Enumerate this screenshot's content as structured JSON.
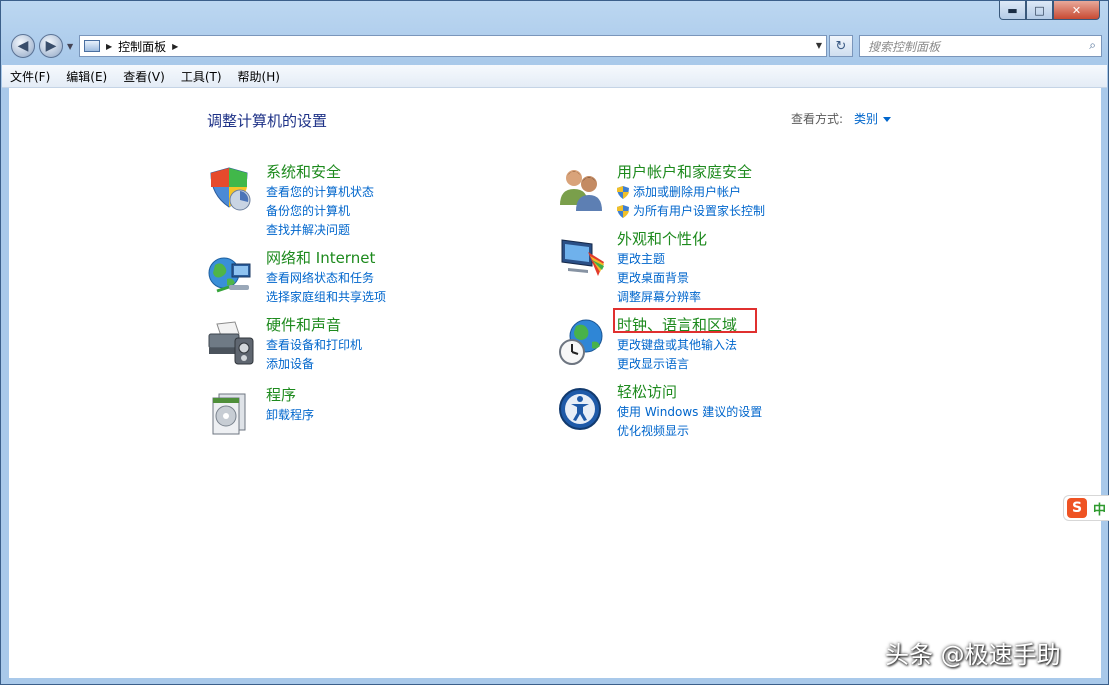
{
  "window": {
    "controls": {
      "minimize": "▬",
      "maximize": "□",
      "close": "✕"
    }
  },
  "nav": {
    "back_icon": "arrow-left-icon",
    "forward_icon": "arrow-right-icon",
    "breadcrumb": "控制面板",
    "search_placeholder": "搜索控制面板"
  },
  "menu": [
    "文件(F)",
    "编辑(E)",
    "查看(V)",
    "工具(T)",
    "帮助(H)"
  ],
  "page": {
    "title": "调整计算机的设置",
    "view_by_label": "查看方式:",
    "view_by_value": "类别"
  },
  "categories": [
    {
      "title": "系统和安全",
      "icon": "shield-icon",
      "links": [
        {
          "text": "查看您的计算机状态"
        },
        {
          "text": "备份您的计算机"
        },
        {
          "text": "查找并解决问题"
        }
      ]
    },
    {
      "title": "网络和 Internet",
      "icon": "network-globe-icon",
      "links": [
        {
          "text": "查看网络状态和任务"
        },
        {
          "text": "选择家庭组和共享选项"
        }
      ]
    },
    {
      "title": "硬件和声音",
      "icon": "printer-icon",
      "links": [
        {
          "text": "查看设备和打印机"
        },
        {
          "text": "添加设备"
        }
      ]
    },
    {
      "title": "程序",
      "icon": "programs-icon",
      "links": [
        {
          "text": "卸载程序"
        }
      ]
    },
    {
      "title": "用户帐户和家庭安全",
      "icon": "users-icon",
      "links": [
        {
          "text": "添加或删除用户帐户",
          "shield": true
        },
        {
          "text": "为所有用户设置家长控制",
          "shield": true
        }
      ]
    },
    {
      "title": "外观和个性化",
      "icon": "monitor-icon",
      "links": [
        {
          "text": "更改主题"
        },
        {
          "text": "更改桌面背景"
        },
        {
          "text": "调整屏幕分辨率"
        }
      ]
    },
    {
      "title": "时钟、语言和区域",
      "icon": "clock-globe-icon",
      "links": [
        {
          "text": "更改键盘或其他输入法"
        },
        {
          "text": "更改显示语言"
        }
      ]
    },
    {
      "title": "轻松访问",
      "icon": "ease-of-access-icon",
      "links": [
        {
          "text": "使用 Windows 建议的设置"
        },
        {
          "text": "优化视频显示"
        }
      ]
    }
  ],
  "ime": {
    "logo": "S",
    "label": "中"
  },
  "watermark": "头条 @极速手助"
}
